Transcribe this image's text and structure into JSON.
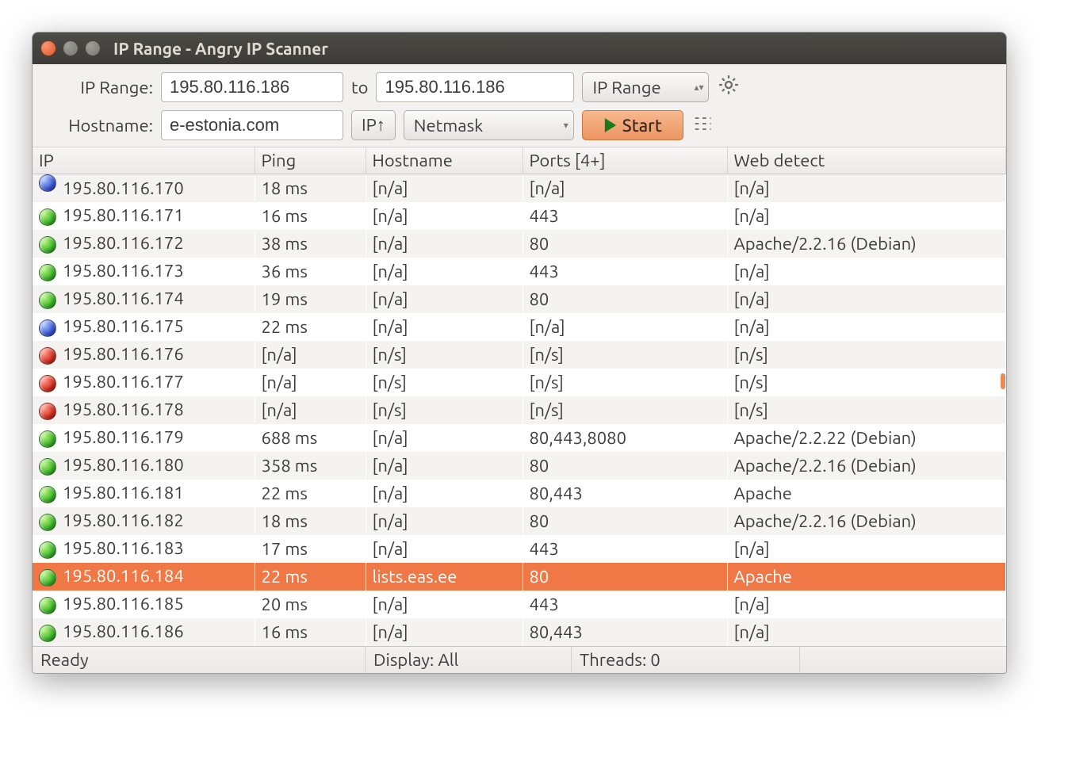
{
  "window": {
    "title": "IP Range - Angry IP Scanner"
  },
  "toolbar": {
    "ip_range_label": "IP Range:",
    "ip_from": "195.80.116.186",
    "to_label": "to",
    "ip_to": "195.80.116.186",
    "feeder_label": "IP Range",
    "hostname_label": "Hostname:",
    "hostname": "e-estonia.com",
    "ip_button": "IP↑",
    "netmask_label": "Netmask",
    "start_label": "Start"
  },
  "columns": {
    "ip": "IP",
    "ping": "Ping",
    "hostname": "Hostname",
    "ports": "Ports [4+]",
    "web": "Web detect"
  },
  "rows": [
    {
      "status": "blue",
      "ip": "195.80.116.170",
      "ping": "18 ms",
      "hostname": "[n/a]",
      "ports": "[n/a]",
      "web": "[n/a]",
      "truncated_top": true
    },
    {
      "status": "green",
      "ip": "195.80.116.171",
      "ping": "16 ms",
      "hostname": "[n/a]",
      "ports": "443",
      "web": "[n/a]"
    },
    {
      "status": "green",
      "ip": "195.80.116.172",
      "ping": "38 ms",
      "hostname": "[n/a]",
      "ports": "80",
      "web": "Apache/2.2.16 (Debian)"
    },
    {
      "status": "green",
      "ip": "195.80.116.173",
      "ping": "36 ms",
      "hostname": "[n/a]",
      "ports": "443",
      "web": "[n/a]"
    },
    {
      "status": "green",
      "ip": "195.80.116.174",
      "ping": "19 ms",
      "hostname": "[n/a]",
      "ports": "80",
      "web": "[n/a]"
    },
    {
      "status": "blue",
      "ip": "195.80.116.175",
      "ping": "22 ms",
      "hostname": "[n/a]",
      "ports": "[n/a]",
      "web": "[n/a]"
    },
    {
      "status": "red",
      "ip": "195.80.116.176",
      "ping": "[n/a]",
      "hostname": "[n/s]",
      "ports": "[n/s]",
      "web": "[n/s]"
    },
    {
      "status": "red",
      "ip": "195.80.116.177",
      "ping": "[n/a]",
      "hostname": "[n/s]",
      "ports": "[n/s]",
      "web": "[n/s]"
    },
    {
      "status": "red",
      "ip": "195.80.116.178",
      "ping": "[n/a]",
      "hostname": "[n/s]",
      "ports": "[n/s]",
      "web": "[n/s]"
    },
    {
      "status": "green",
      "ip": "195.80.116.179",
      "ping": "688 ms",
      "hostname": "[n/a]",
      "ports": "80,443,8080",
      "web": "Apache/2.2.22 (Debian)"
    },
    {
      "status": "green",
      "ip": "195.80.116.180",
      "ping": "358 ms",
      "hostname": "[n/a]",
      "ports": "80",
      "web": "Apache/2.2.16 (Debian)"
    },
    {
      "status": "green",
      "ip": "195.80.116.181",
      "ping": "22 ms",
      "hostname": "[n/a]",
      "ports": "80,443",
      "web": "Apache"
    },
    {
      "status": "green",
      "ip": "195.80.116.182",
      "ping": "18 ms",
      "hostname": "[n/a]",
      "ports": "80",
      "web": "Apache/2.2.16 (Debian)"
    },
    {
      "status": "green",
      "ip": "195.80.116.183",
      "ping": "17 ms",
      "hostname": "[n/a]",
      "ports": "443",
      "web": "[n/a]"
    },
    {
      "status": "green",
      "ip": "195.80.116.184",
      "ping": "22 ms",
      "hostname": "lists.eas.ee",
      "ports": "80",
      "web": "Apache",
      "selected": true
    },
    {
      "status": "green",
      "ip": "195.80.116.185",
      "ping": "20 ms",
      "hostname": "[n/a]",
      "ports": "443",
      "web": "[n/a]"
    },
    {
      "status": "green",
      "ip": "195.80.116.186",
      "ping": "16 ms",
      "hostname": "[n/a]",
      "ports": "80,443",
      "web": "[n/a]"
    }
  ],
  "status": {
    "ready": "Ready",
    "display": "Display: All",
    "threads": "Threads: 0"
  }
}
